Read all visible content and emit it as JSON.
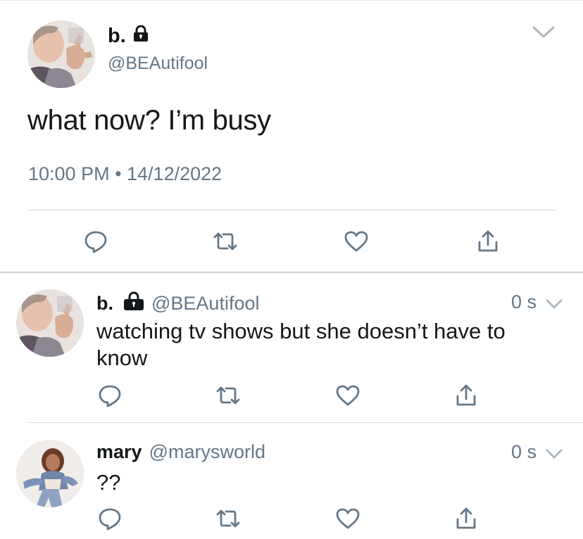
{
  "main_tweet": {
    "display_name": "b.",
    "handle": "@BEAutifool",
    "text": "what now? I’m busy",
    "timestamp": "10:00 PM • 14/12/2022",
    "protected_icon": "lock-icon",
    "menu_icon": "chevron-down-icon"
  },
  "actions": {
    "reply_icon": "reply-icon",
    "retweet_icon": "retweet-icon",
    "like_icon": "heart-icon",
    "share_icon": "share-icon"
  },
  "replies": [
    {
      "display_name": "b.",
      "handle": "@BEAutifool",
      "time": "0 s",
      "text": "watching tv shows but she doesn’t have to know",
      "protected": true
    },
    {
      "display_name": "mary",
      "handle": "@marysworld",
      "time": "0 s",
      "text": "??",
      "protected": false
    }
  ],
  "colors": {
    "text": "#14171a",
    "secondary": "#657786",
    "icon": "#657786",
    "divider": "#d6dde2"
  }
}
